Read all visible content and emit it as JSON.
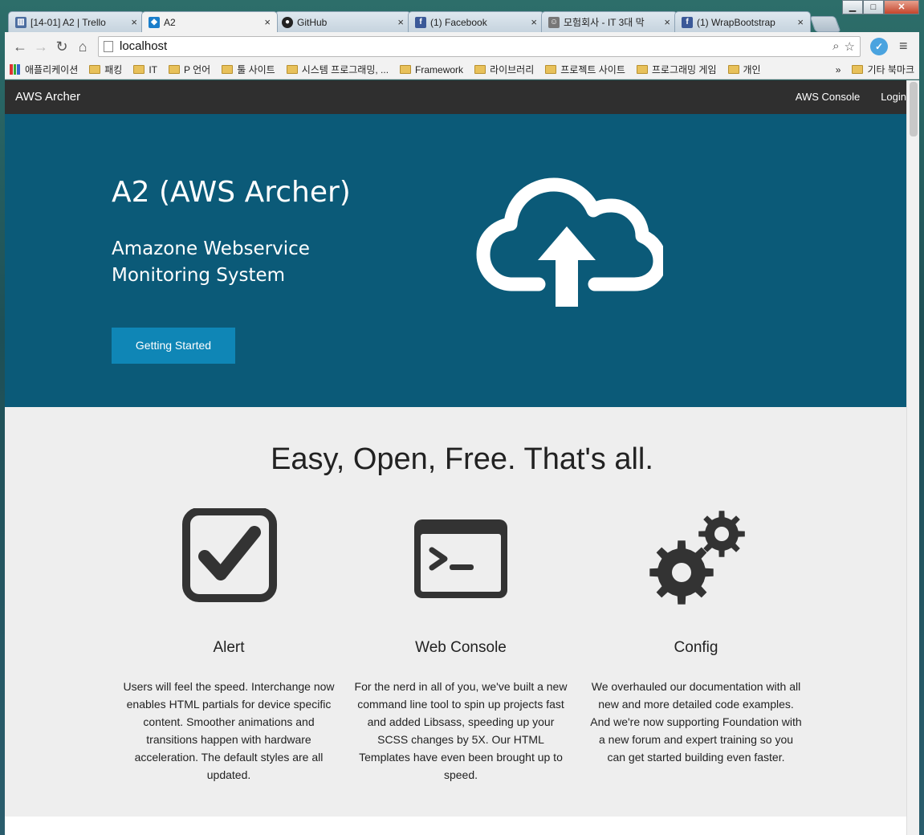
{
  "browser": {
    "tabs": [
      {
        "label": "[14-01] A2 | Trello",
        "icon": "trello-icon",
        "color": "#4b6da0",
        "glyph": "▥"
      },
      {
        "label": "A2",
        "icon": "app-icon",
        "color": "#1a7ecb",
        "glyph": "◆"
      },
      {
        "label": "GitHub",
        "icon": "github-icon",
        "color": "#222222",
        "glyph": "●"
      },
      {
        "label": "(1) Facebook",
        "icon": "facebook-icon",
        "color": "#3b5998",
        "glyph": "f"
      },
      {
        "label": "모험회사 - IT 3대 막",
        "icon": "site-icon",
        "color": "#777777",
        "glyph": "☺"
      },
      {
        "label": "(1) WrapBootstrap",
        "icon": "facebook-icon",
        "color": "#3b5998",
        "glyph": "f"
      }
    ],
    "url": "localhost",
    "bookmarks": [
      {
        "label": "애플리케이션",
        "type": "apps"
      },
      {
        "label": "패킹",
        "type": "folder"
      },
      {
        "label": "IT",
        "type": "folder"
      },
      {
        "label": "P 언어",
        "type": "folder"
      },
      {
        "label": "툴 사이트",
        "type": "folder"
      },
      {
        "label": "시스템 프로그래밍, ...",
        "type": "folder"
      },
      {
        "label": "Framework",
        "type": "folder"
      },
      {
        "label": "라이브러리",
        "type": "folder"
      },
      {
        "label": "프로젝트 사이트",
        "type": "folder"
      },
      {
        "label": "프로그래밍 게임",
        "type": "folder"
      },
      {
        "label": "개인",
        "type": "folder"
      }
    ],
    "bookmarks_more": "»",
    "other_bookmarks": "기타 북마크"
  },
  "navbar": {
    "brand": "AWS Archer",
    "links": [
      "AWS Console",
      "Login"
    ]
  },
  "hero": {
    "title": "A2 (AWS Archer)",
    "subtitle_line1": "Amazone Webservice",
    "subtitle_line2": "Monitoring System",
    "button": "Getting Started"
  },
  "features": {
    "tagline": "Easy, Open, Free. That's all.",
    "items": [
      {
        "title": "Alert",
        "icon": "checkbox-icon",
        "text": "Users will feel the speed. Interchange now enables HTML partials for device specific content. Smoother animations and transitions happen with hardware acceleration. The default styles are all updated."
      },
      {
        "title": "Web Console",
        "icon": "terminal-icon",
        "text": "For the nerd in all of you, we've built a new command line tool to spin up projects fast and added Libsass, speeding up your SCSS changes by 5X. Our HTML Templates have even been brought up to speed."
      },
      {
        "title": "Config",
        "icon": "gears-icon",
        "text": "We overhauled our documentation with all new and more detailed code examples. And we're now supporting Foundation with a new forum and expert training so you can get started building even faster."
      }
    ]
  },
  "colors": {
    "navbar": "#2f2f2f",
    "hero": "#0b5a78",
    "button": "#0f86b6",
    "features_bg": "#eeeeee",
    "icon": "#333333"
  }
}
